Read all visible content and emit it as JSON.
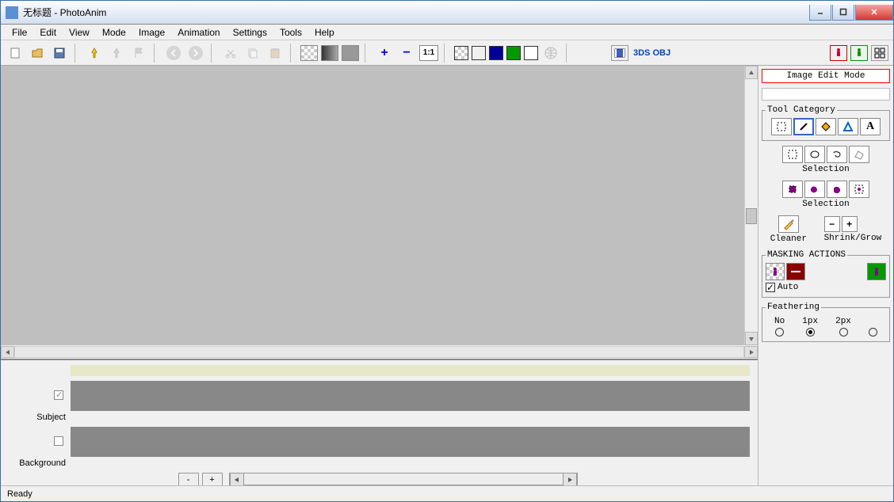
{
  "titlebar": {
    "text": "无标题 - PhotoAnim"
  },
  "menu": {
    "file": "File",
    "edit": "Edit",
    "view": "View",
    "mode": "Mode",
    "image": "Image",
    "animation": "Animation",
    "settings": "Settings",
    "tools": "Tools",
    "help": "Help"
  },
  "toolbar": {
    "ratio": "1:1",
    "obj3ds": "3DS OBJ",
    "colors": {
      "black": "#000000",
      "blue": "#000099",
      "green": "#009900",
      "white": "#ffffff"
    }
  },
  "side": {
    "mode": "Image Edit Mode",
    "tool_category": "Tool Category",
    "selection1": "Selection",
    "selection2": "Selection",
    "cleaner": "Cleaner",
    "shrink_grow": "Shrink/Grow",
    "masking_actions": "MASKING ACTIONS",
    "auto": "Auto",
    "feathering": "Feathering",
    "feather_opts": {
      "no": "No",
      "px1": "1px",
      "px2": "2px"
    }
  },
  "timeline": {
    "subject": "Subject",
    "background": "Background",
    "minus": "-",
    "plus": "+"
  },
  "status": {
    "ready": "Ready"
  }
}
